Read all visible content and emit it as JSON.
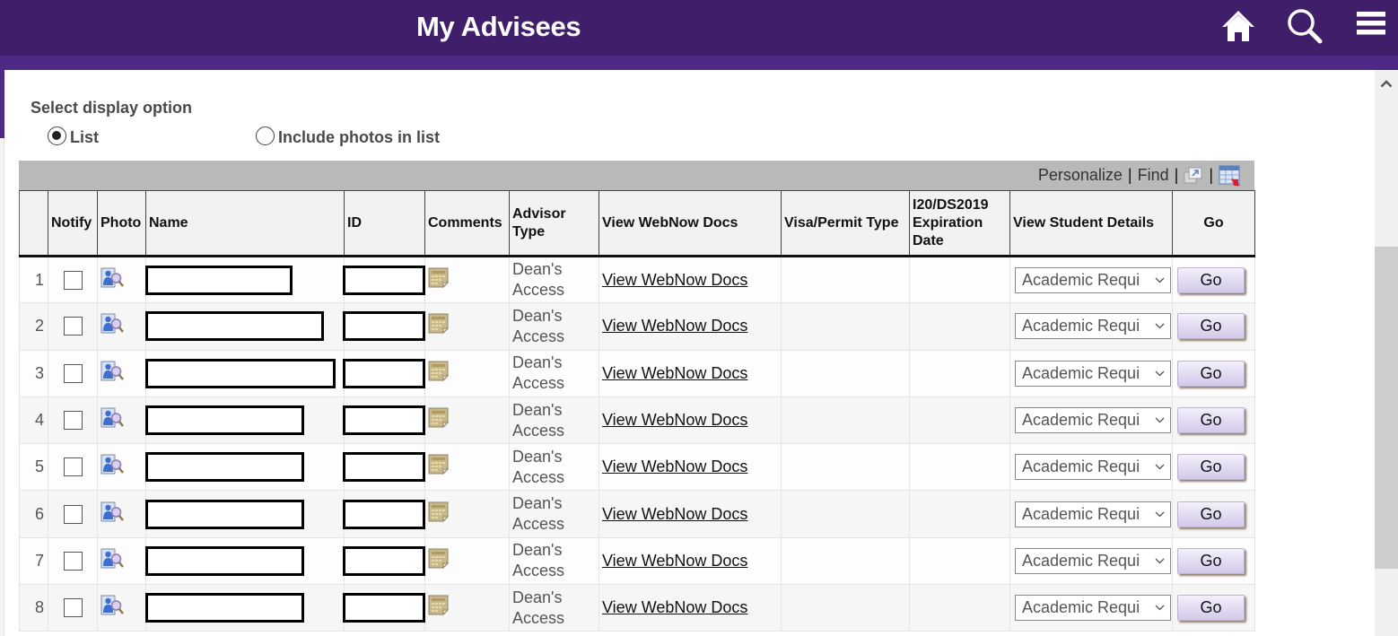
{
  "header": {
    "title": "My Advisees",
    "icons": [
      "home-icon",
      "search-icon",
      "menu-icon"
    ]
  },
  "display_option": {
    "label": "Select display option",
    "options": [
      {
        "label": "List",
        "selected": true
      },
      {
        "label": "Include photos in list",
        "selected": false
      }
    ]
  },
  "toolbar": {
    "personalize": "Personalize",
    "find": "Find",
    "separator": "|",
    "icons": [
      "new-window-icon",
      "download-spreadsheet-icon"
    ]
  },
  "table": {
    "columns": [
      "",
      "Notify",
      "Photo",
      "Name",
      "ID",
      "Comments",
      "Advisor Type",
      "View WebNow Docs",
      "Visa/Permit Type",
      "I20/DS2019 Expiration Date",
      "View Student Details",
      "Go"
    ],
    "rows": [
      {
        "num": "1",
        "notify": false,
        "name": "",
        "id": "",
        "advisor_type": "Dean's Access",
        "webnow": "View WebNow Docs",
        "visa": "",
        "expiration": "",
        "details": "Academic Requi",
        "go": "Go"
      },
      {
        "num": "2",
        "notify": false,
        "name": "",
        "id": "",
        "advisor_type": "Dean's Access",
        "webnow": "View WebNow Docs",
        "visa": "",
        "expiration": "",
        "details": "Academic Requi",
        "go": "Go"
      },
      {
        "num": "3",
        "notify": false,
        "name": "",
        "id": "",
        "advisor_type": "Dean's Access",
        "webnow": "View WebNow Docs",
        "visa": "",
        "expiration": "",
        "details": "Academic Requi",
        "go": "Go"
      },
      {
        "num": "4",
        "notify": false,
        "name": "",
        "id": "",
        "advisor_type": "Dean's Access",
        "webnow": "View WebNow Docs",
        "visa": "",
        "expiration": "",
        "details": "Academic Requi",
        "go": "Go"
      },
      {
        "num": "5",
        "notify": false,
        "name": "",
        "id": "",
        "advisor_type": "Dean's Access",
        "webnow": "View WebNow Docs",
        "visa": "",
        "expiration": "",
        "details": "Academic Requi",
        "go": "Go"
      },
      {
        "num": "6",
        "notify": false,
        "name": "",
        "id": "",
        "advisor_type": "Dean's Access",
        "webnow": "View WebNow Docs",
        "visa": "",
        "expiration": "",
        "details": "Academic Requi",
        "go": "Go"
      },
      {
        "num": "7",
        "notify": false,
        "name": "",
        "id": "",
        "advisor_type": "Dean's Access",
        "webnow": "View WebNow Docs",
        "visa": "",
        "expiration": "",
        "details": "Academic Requi",
        "go": "Go"
      },
      {
        "num": "8",
        "notify": false,
        "name": "",
        "id": "",
        "advisor_type": "Dean's Access",
        "webnow": "View WebNow Docs",
        "visa": "",
        "expiration": "",
        "details": "Academic Requi",
        "go": "Go"
      }
    ]
  },
  "colors": {
    "header_bg": "#3f1f69",
    "header_stripe": "#4d2a85",
    "toolbar_bg": "#b9b9b9",
    "go_button": "#d2c9ea"
  }
}
